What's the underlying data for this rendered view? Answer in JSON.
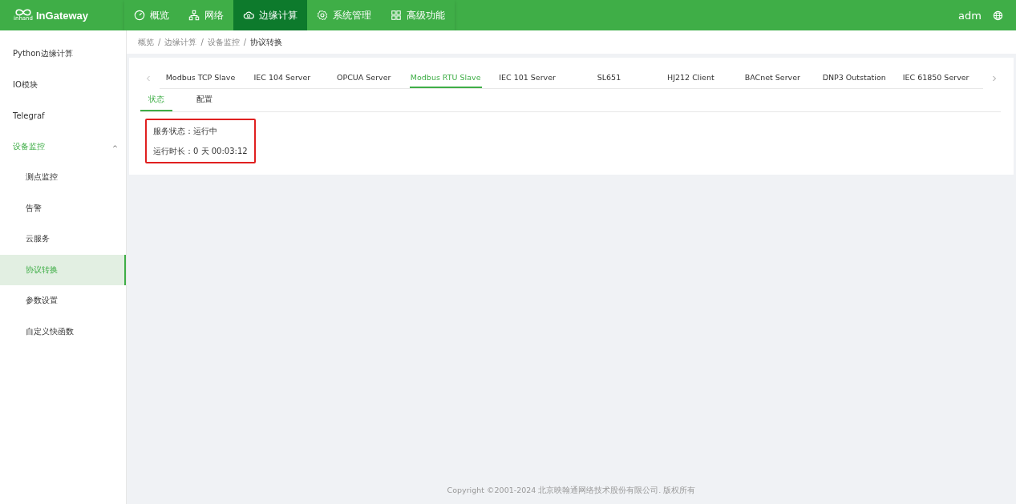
{
  "brand": {
    "logo_text": "inhand",
    "name": "InGateway"
  },
  "nav": [
    {
      "label": "概览",
      "kind": "gauge",
      "selected": false
    },
    {
      "label": "网络",
      "kind": "network",
      "selected": false
    },
    {
      "label": "边缘计算",
      "kind": "cloud",
      "selected": true
    },
    {
      "label": "系统管理",
      "kind": "gear",
      "selected": false
    },
    {
      "label": "高级功能",
      "kind": "grid",
      "selected": false
    }
  ],
  "user": "adm",
  "sidebar": {
    "items": [
      {
        "label": "Python边缘计算",
        "selected": false
      },
      {
        "label": "IO模块",
        "selected": false
      },
      {
        "label": "Telegraf",
        "selected": false
      },
      {
        "label": "设备监控",
        "selected": true,
        "expanded": true,
        "children": [
          {
            "label": "测点监控",
            "selected": false
          },
          {
            "label": "告警",
            "selected": false
          },
          {
            "label": "云服务",
            "selected": false
          },
          {
            "label": "协议转换",
            "selected": true
          },
          {
            "label": "参数设置",
            "selected": false
          },
          {
            "label": "自定义快函数",
            "selected": false
          }
        ]
      }
    ]
  },
  "breadcrumb": [
    "概览",
    "边缘计算",
    "设备监控",
    "协议转换"
  ],
  "breadcrumb_separator": "/",
  "tabs": [
    {
      "label": "Modbus TCP Slave",
      "selected": false
    },
    {
      "label": "IEC 104 Server",
      "selected": false
    },
    {
      "label": "OPCUA Server",
      "selected": false
    },
    {
      "label": "Modbus RTU Slave",
      "selected": true
    },
    {
      "label": "IEC 101 Server",
      "selected": false
    },
    {
      "label": "SL651",
      "selected": false
    },
    {
      "label": "HJ212 Client",
      "selected": false
    },
    {
      "label": "BACnet Server",
      "selected": false
    },
    {
      "label": "DNP3 Outstation",
      "selected": false
    },
    {
      "label": "IEC 61850 Server",
      "selected": false
    }
  ],
  "subtabs": [
    {
      "label": "状态",
      "selected": true
    },
    {
      "label": "配置",
      "selected": false
    }
  ],
  "status_lines": [
    "服务状态：运行中",
    "运行时长：0 天 00:03:12"
  ],
  "footer": "Copyright ©2001-2024 北京映翰通网络技术股份有限公司. 版权所有"
}
